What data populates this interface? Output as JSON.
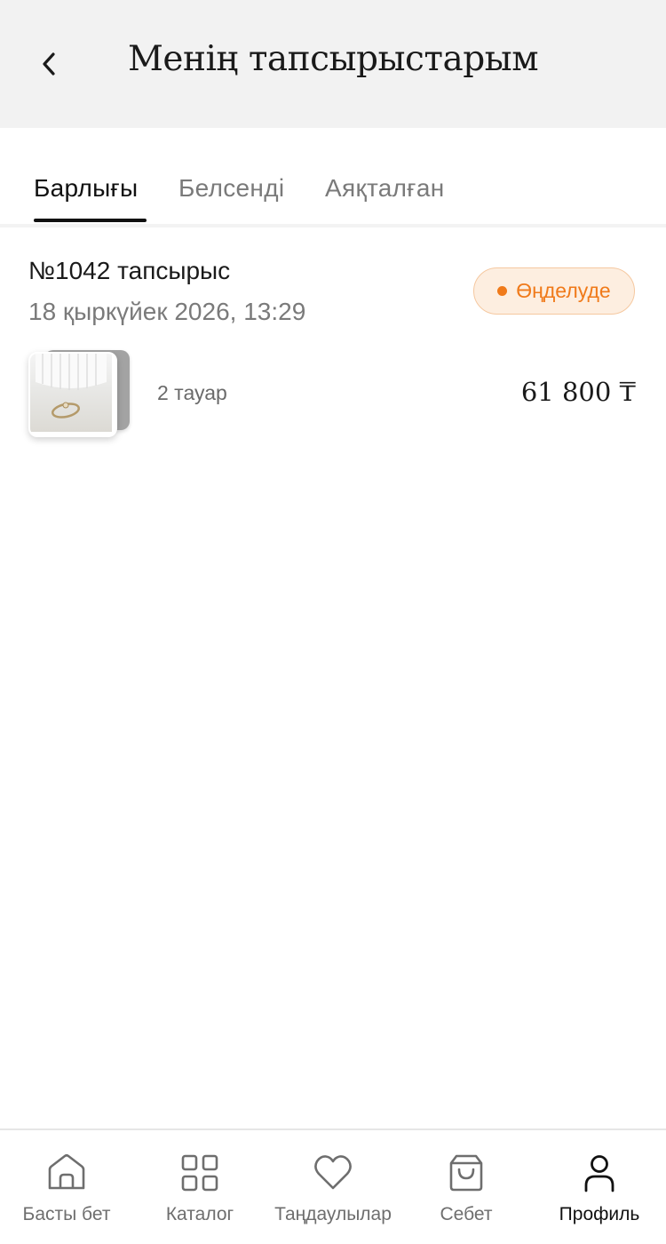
{
  "header": {
    "title": "Менің тапсырыстарым",
    "back_icon": "chevron-left-icon"
  },
  "tabs": [
    {
      "label": "Барлығы",
      "active": true
    },
    {
      "label": "Белсенді",
      "active": false
    },
    {
      "label": "Аяқталған",
      "active": false
    }
  ],
  "orders": [
    {
      "number": "№1042 тапсырыс",
      "date": "18 қыркүйек 2026, 13:29",
      "status": "Өңделуде",
      "status_color": "#f07a1a",
      "items_count": "2 тауар",
      "total": "61 800 ₸"
    }
  ],
  "bottom_nav": [
    {
      "label": "Басты бет",
      "icon": "home-icon",
      "active": false
    },
    {
      "label": "Каталог",
      "icon": "grid-icon",
      "active": false
    },
    {
      "label": "Таңдаулылар",
      "icon": "heart-icon",
      "active": false
    },
    {
      "label": "Себет",
      "icon": "shopping-bag-icon",
      "active": false
    },
    {
      "label": "Профиль",
      "icon": "user-icon",
      "active": true
    }
  ]
}
